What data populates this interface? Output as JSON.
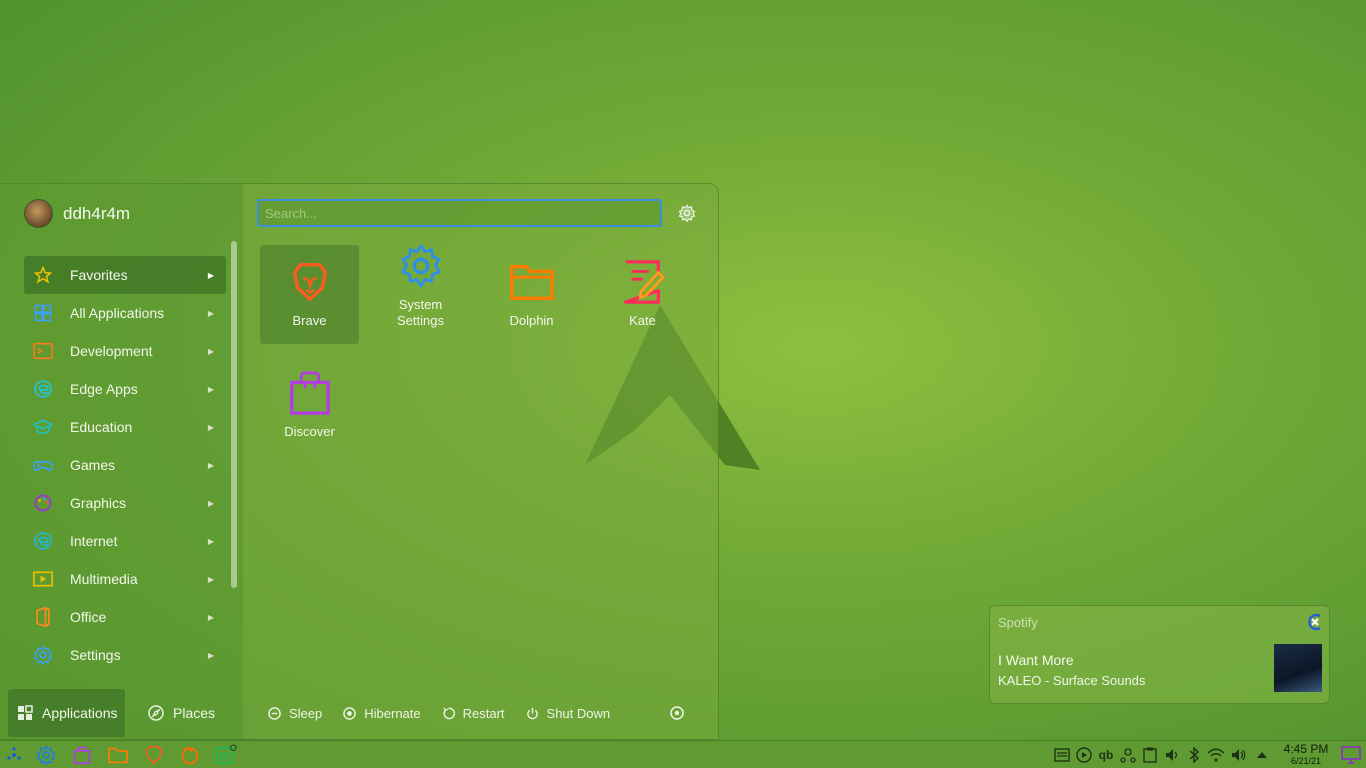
{
  "launcher": {
    "username": "ddh4r4m",
    "search_placeholder": "Search...",
    "categories": [
      {
        "label": "Favorites",
        "icon": "star-icon"
      },
      {
        "label": "All Applications",
        "icon": "grid-icon"
      },
      {
        "label": "Development",
        "icon": "terminal-icon"
      },
      {
        "label": "Edge Apps",
        "icon": "edge-icon"
      },
      {
        "label": "Education",
        "icon": "graduation-cap-icon"
      },
      {
        "label": "Games",
        "icon": "gamepad-icon"
      },
      {
        "label": "Graphics",
        "icon": "palette-icon"
      },
      {
        "label": "Internet",
        "icon": "globe-icon"
      },
      {
        "label": "Multimedia",
        "icon": "media-icon"
      },
      {
        "label": "Office",
        "icon": "office-icon"
      },
      {
        "label": "Settings",
        "icon": "settings-gear-icon"
      }
    ],
    "apps": [
      {
        "label": "Brave",
        "icon": "brave-lion-icon"
      },
      {
        "label": "System Settings",
        "icon": "system-settings-icon"
      },
      {
        "label": "Dolphin",
        "icon": "folder-icon"
      },
      {
        "label": "Kate",
        "icon": "kate-editor-icon"
      },
      {
        "label": "Discover",
        "icon": "shopping-bag-icon"
      }
    ],
    "power": {
      "sleep": "Sleep",
      "hibernate": "Hibernate",
      "restart": "Restart",
      "shutdown": "Shut Down"
    },
    "tabs": {
      "applications": "Applications",
      "places": "Places"
    }
  },
  "notification": {
    "app": "Spotify",
    "title": "I Want More",
    "body": "KALEO - Surface Sounds"
  },
  "taskbar": {
    "clock_time": "4:45 PM",
    "clock_date": "6/21/21",
    "tray_qb": "qb"
  },
  "colors": {
    "accent": "#3d8ee0",
    "panel": "#5f9a33"
  }
}
